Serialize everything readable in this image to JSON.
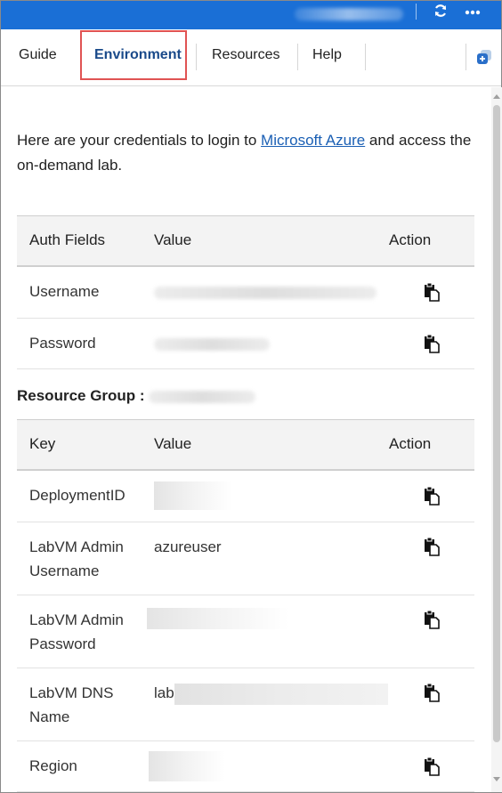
{
  "tabs": {
    "guide": "Guide",
    "environment": "Environment",
    "resources": "Resources",
    "help": "Help"
  },
  "intro": {
    "before_link": "Here are your credentials to login to ",
    "link": "Microsoft Azure",
    "after_link": " and access the on-demand lab."
  },
  "auth_table": {
    "headers": [
      "Auth Fields",
      "Value",
      "Action"
    ],
    "rows": [
      {
        "field": "Username",
        "value": ""
      },
      {
        "field": "Password",
        "value": ""
      }
    ]
  },
  "resource_group": {
    "label": "Resource Group :"
  },
  "resource_table": {
    "headers": [
      "Key",
      "Value",
      "Action"
    ],
    "rows": [
      {
        "key": "DeploymentID",
        "value": ""
      },
      {
        "key": "LabVM Admin Username",
        "value": "azureuser"
      },
      {
        "key": "LabVM Admin Password",
        "value": ""
      },
      {
        "key": "LabVM DNS Name",
        "value": "lab"
      },
      {
        "key": "Region",
        "value": ""
      }
    ]
  },
  "icons": {
    "refresh": "refresh-icon",
    "more": "more-icon",
    "expand": "expand-panel-icon",
    "copy": "copy-icon"
  },
  "colors": {
    "topbar": "#1a6fd6",
    "active_tab": "#1a4a8a",
    "highlight_box": "#e05353",
    "link": "#1a5fb4"
  }
}
